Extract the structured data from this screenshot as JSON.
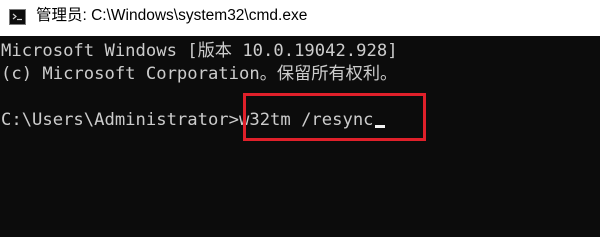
{
  "window": {
    "title": "管理员: C:\\Windows\\system32\\cmd.exe",
    "icon": "cmd-icon"
  },
  "console": {
    "line1": "Microsoft Windows [版本 10.0.19042.928]",
    "line2": "(c) Microsoft Corporation。保留所有权利。",
    "prompt": "C:\\Users\\Administrator>",
    "command": "w32tm /resync"
  },
  "colors": {
    "console_background": "#0c0c0c",
    "console_text": "#cccccc",
    "highlight_border": "#e0202a",
    "titlebar_background": "#ffffff"
  }
}
